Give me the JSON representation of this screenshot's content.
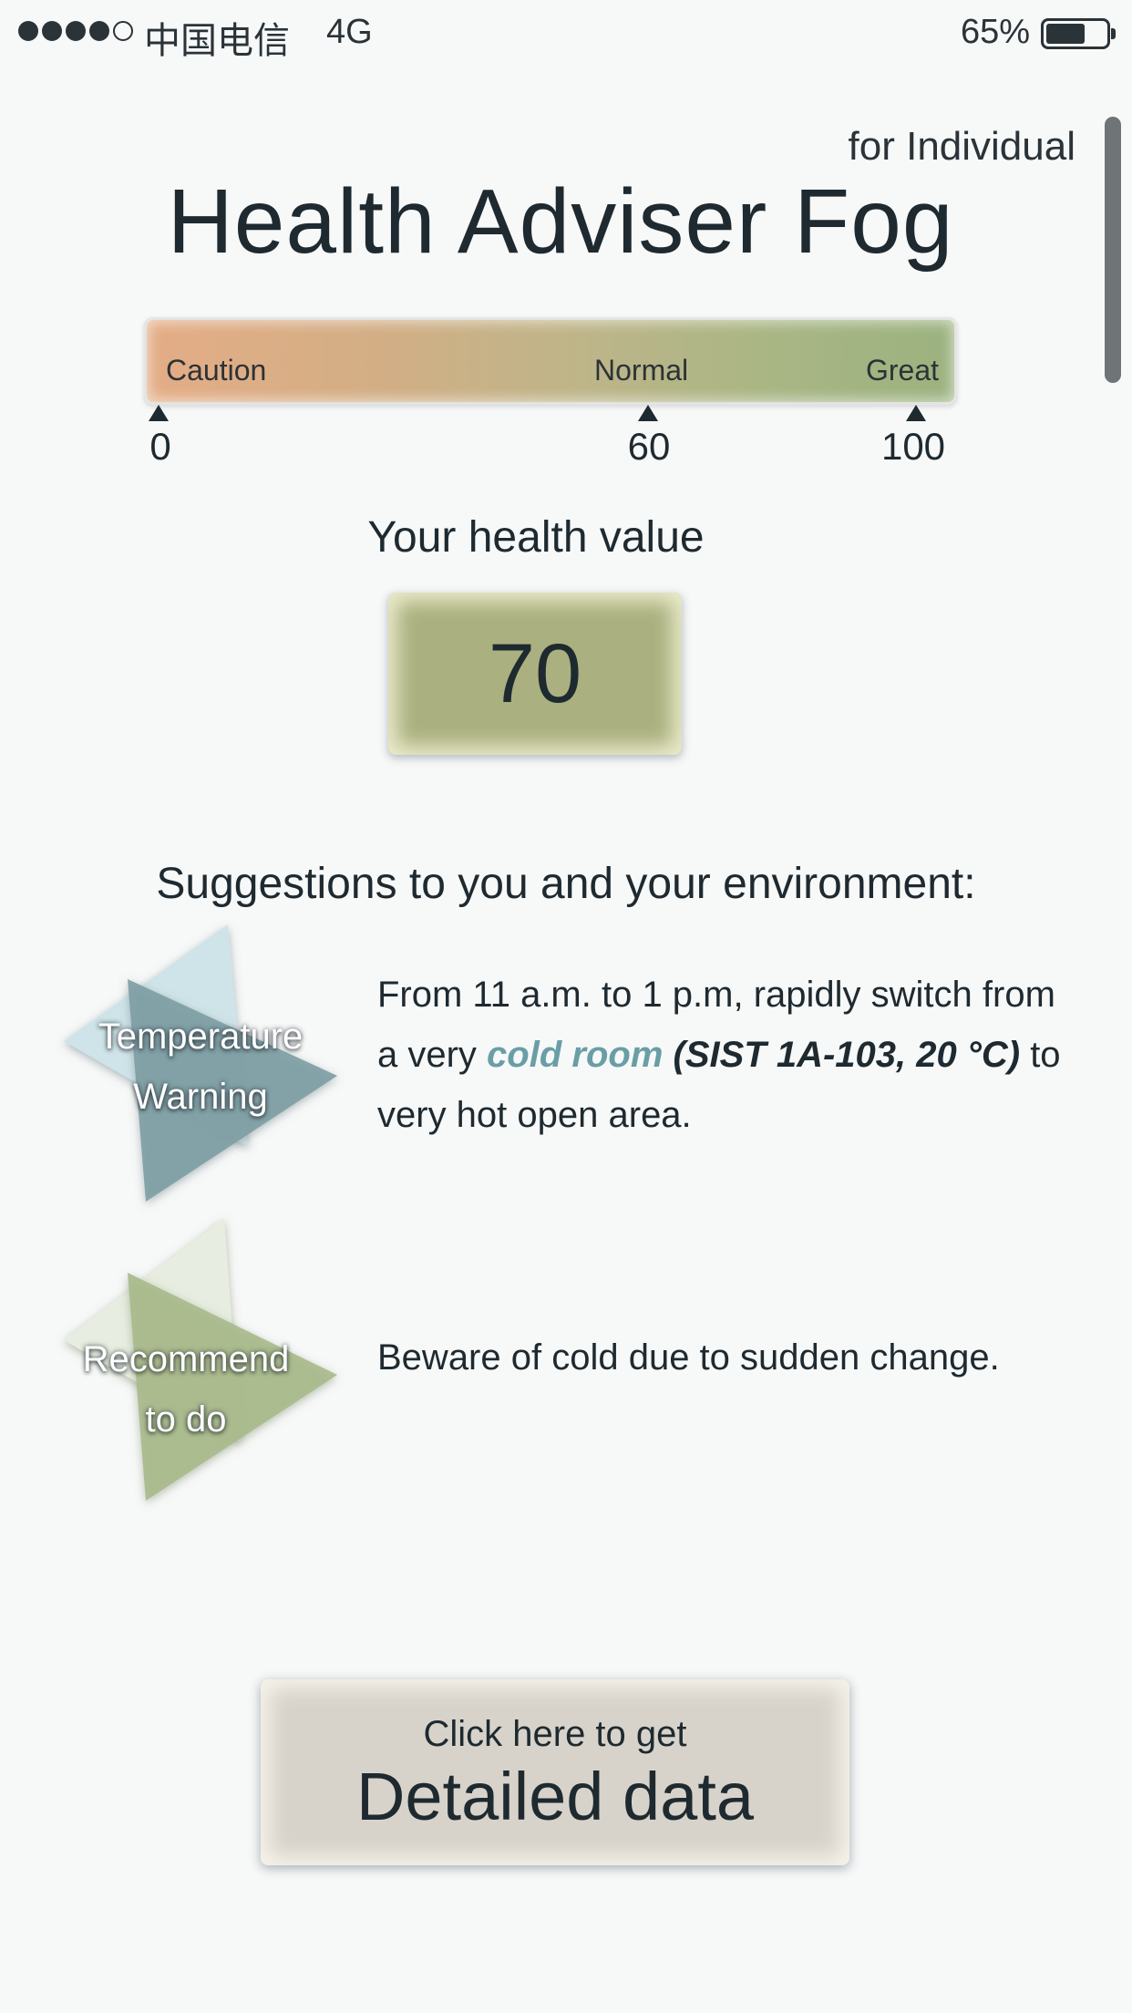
{
  "status_bar": {
    "carrier": "中国电信",
    "network": "4G",
    "battery_percent": "65%",
    "battery_level": 0.65,
    "signal_bars_filled": 4,
    "signal_bars_total": 5
  },
  "header": {
    "subtitle": "for Individual",
    "title": "Health Adviser Fog"
  },
  "gauge": {
    "labels": {
      "caution": "Caution",
      "normal": "Normal",
      "great": "Great"
    },
    "ticks": [
      "0",
      "60",
      "100"
    ],
    "colors": {
      "caution": "#e4ad86",
      "normal": "#bdb589",
      "great": "#9bb27f"
    }
  },
  "health": {
    "label": "Your health value",
    "value": "70",
    "box_color": "#aab07f"
  },
  "suggestions": {
    "heading": "Suggestions to you and your environment:",
    "items": [
      {
        "badge_line1": "Temperature",
        "badge_line2": "Warning",
        "icon": "temperature-warning-icon",
        "colors": {
          "light": "#cfe4e8",
          "dark": "#7f9fa5"
        },
        "text_part1": "From 11 a.m. to 1 p.m, rapidly switch from a very ",
        "text_cold": "cold room",
        "text_location": " (SIST 1A-103, 20 °C)",
        "text_part2": " to very hot open area."
      },
      {
        "badge_line1": "Recommend",
        "badge_line2": "to do",
        "icon": "recommend-icon",
        "colors": {
          "light": "#e7ede0",
          "dark": "#a9bb8c"
        },
        "text": "Beware of cold due to sudden change."
      }
    ]
  },
  "detail_button": {
    "top_label": "Click here to get",
    "main_label": "Detailed data"
  }
}
